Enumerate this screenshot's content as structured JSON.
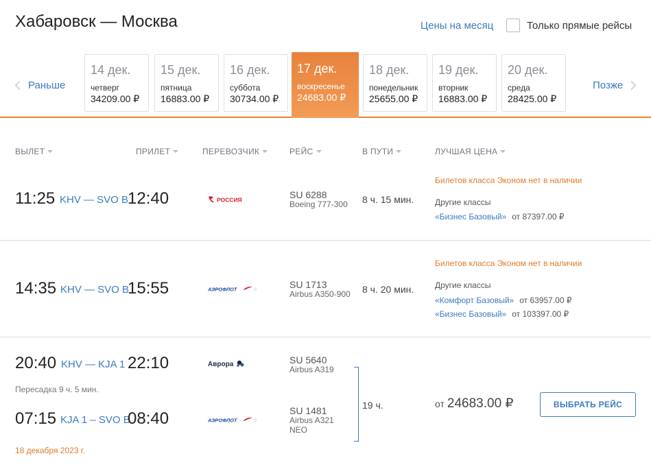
{
  "header": {
    "route": "Хабаровск — Москва",
    "month_prices_link": "Цены на месяц",
    "direct_only_label": "Только прямые рейсы",
    "direct_only_checked": false
  },
  "date_nav": {
    "prev_label": "Раньше",
    "next_label": "Позже",
    "days": [
      {
        "date": "14 дек.",
        "weekday": "четверг",
        "price": "34209.00 ₽",
        "active": false
      },
      {
        "date": "15 дек.",
        "weekday": "пятница",
        "price": "16883.00 ₽",
        "active": false
      },
      {
        "date": "16 дек.",
        "weekday": "суббота",
        "price": "30734.00 ₽",
        "active": false
      },
      {
        "date": "17 дек.",
        "weekday": "воскресенье",
        "price": "24683.00 ₽",
        "active": true
      },
      {
        "date": "18 дек.",
        "weekday": "понедельник",
        "price": "25655.00 ₽",
        "active": false
      },
      {
        "date": "19 дек.",
        "weekday": "вторник",
        "price": "16883.00 ₽",
        "active": false
      },
      {
        "date": "20 дек.",
        "weekday": "среда",
        "price": "28425.00 ₽",
        "active": false
      }
    ]
  },
  "columns": [
    "ВЫЛЕТ",
    "ПРИЛЕТ",
    "ПЕРЕВОЗЧИК",
    "РЕЙС",
    "В ПУТИ",
    "ЛУЧШАЯ ЦЕНА"
  ],
  "flights": [
    {
      "departure": "11:25",
      "route": "KHV — SVO B",
      "arrival": "12:40",
      "carrier": "РОССИЯ",
      "flight_no": "SU 6288",
      "aircraft": "Boeing 777-300",
      "duration": "8 ч. 15 мин.",
      "no_economy": "Билетов класса Эконом нет в наличии",
      "other_classes_label": "Другие классы",
      "classes": [
        {
          "name": "«Бизнес Базовый»",
          "price": "от 87397.00 ₽"
        }
      ]
    },
    {
      "departure": "14:35",
      "route": "KHV — SVO B",
      "arrival": "15:55",
      "carrier": "АЭРОФЛОТ",
      "flight_no": "SU 1713",
      "aircraft": "Airbus A350-900",
      "duration": "8 ч. 20 мин.",
      "no_economy": "Билетов класса Эконом нет в наличии",
      "other_classes_label": "Другие классы",
      "classes": [
        {
          "name": "«Комфорт Базовый»",
          "price": "от 63957.00 ₽"
        },
        {
          "name": "«Бизнес Базовый»",
          "price": "от 103397.00 ₽"
        }
      ]
    },
    {
      "legs": [
        {
          "departure": "20:40",
          "route": "KHV — KJA 1",
          "arrival": "22:10",
          "carrier": "Аврора",
          "flight_no": "SU 5640",
          "aircraft": "Airbus A319"
        },
        {
          "departure": "07:15",
          "route": "KJA 1 – SVO B",
          "arrival": "08:40",
          "carrier": "АЭРОФЛОТ",
          "flight_no": "SU 1481",
          "aircraft_line1": "Airbus A321",
          "aircraft_line2": "NEO"
        }
      ],
      "transfer": "Пересадка 9 ч. 5 мин.",
      "arrival_date": "18 декабря 2023 г.",
      "duration": "19 ч.",
      "price_label": "от",
      "price": "24683.00 ₽",
      "select_label": "ВЫБРАТЬ РЕЙС"
    }
  ],
  "colors": {
    "accent_orange": "#e8823a",
    "link_blue": "#3b7bbf",
    "warning_orange": "#e07a2c",
    "rossiya_red": "#d8232a",
    "aeroflot_blue": "#1a4a9c"
  }
}
